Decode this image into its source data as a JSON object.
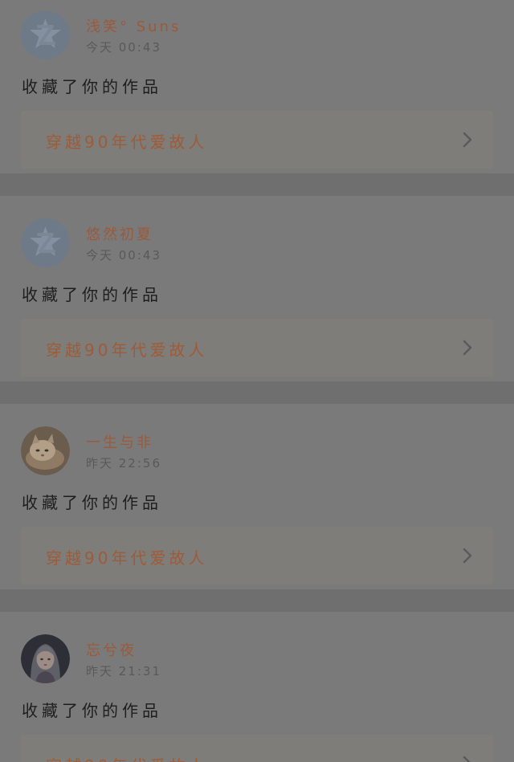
{
  "feed": {
    "items": [
      {
        "user": "浅笑° Suns",
        "time": "今天 00:43",
        "action": "收藏了你的作品",
        "work_title": "穿越90年代爱故人",
        "avatar_icon": "qq-default-avatar-icon"
      },
      {
        "user": "悠然初夏",
        "time": "今天 00:43",
        "action": "收藏了你的作品",
        "work_title": "穿越90年代爱故人",
        "avatar_icon": "qq-default-avatar-icon"
      },
      {
        "user": "一生与非",
        "time": "昨天 22:56",
        "action": "收藏了你的作品",
        "work_title": "穿越90年代爱故人",
        "avatar_icon": "kitten-photo-avatar"
      },
      {
        "user": "忘兮夜",
        "time": "昨天 21:31",
        "action": "收藏了你的作品",
        "work_title": "穿越90年代爱故人",
        "avatar_icon": "girl-portrait-avatar"
      }
    ]
  },
  "colors": {
    "overlay_background": "#6f6f6f",
    "card_background": "#7a7a7a",
    "username": "#9a5a3a",
    "work_title": "#9e5b38"
  }
}
